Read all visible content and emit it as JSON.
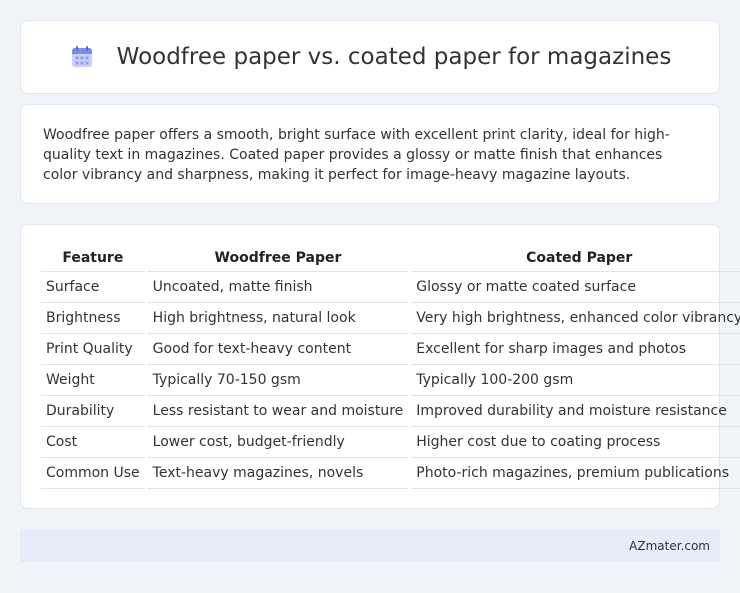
{
  "header": {
    "title": "Woodfree paper vs. coated paper for magazines",
    "icon": "calendar-icon",
    "icon_color": "#7b8cf0"
  },
  "intro": {
    "text": "Woodfree paper offers a smooth, bright surface with excellent print clarity, ideal for high-quality text in magazines. Coated paper provides a glossy or matte finish that enhances color vibrancy and sharpness, making it perfect for image-heavy magazine layouts."
  },
  "table": {
    "headers": [
      "Feature",
      "Woodfree Paper",
      "Coated Paper"
    ],
    "rows": [
      [
        "Surface",
        "Uncoated, matte finish",
        "Glossy or matte coated surface"
      ],
      [
        "Brightness",
        "High brightness, natural look",
        "Very high brightness, enhanced color vibrancy"
      ],
      [
        "Print Quality",
        "Good for text-heavy content",
        "Excellent for sharp images and photos"
      ],
      [
        "Weight",
        "Typically 70-150 gsm",
        "Typically 100-200 gsm"
      ],
      [
        "Durability",
        "Less resistant to wear and moisture",
        "Improved durability and moisture resistance"
      ],
      [
        "Cost",
        "Lower cost, budget-friendly",
        "Higher cost due to coating process"
      ],
      [
        "Common Use",
        "Text-heavy magazines, novels",
        "Photo-rich magazines, premium publications"
      ]
    ]
  },
  "footer": {
    "site": "AZmater.com"
  }
}
